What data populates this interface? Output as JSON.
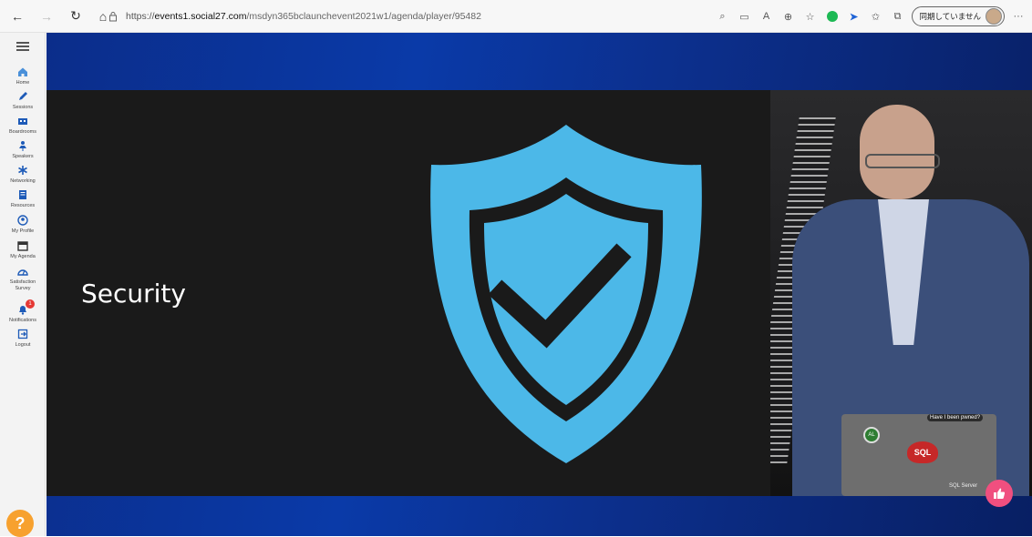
{
  "browser": {
    "url_prefix": "https://",
    "url_host": "events1.social27.com",
    "url_path": "/msdyn365bclaunchevent2021w1/agenda/player/95482",
    "sync_label": "同期していません",
    "more_label": "···"
  },
  "sidebar": {
    "items": [
      {
        "label": "Home",
        "icon": "home-icon"
      },
      {
        "label": "Sessions",
        "icon": "pencil-icon"
      },
      {
        "label": "Boardrooms",
        "icon": "boardroom-icon"
      },
      {
        "label": "Speakers",
        "icon": "speaker-icon"
      },
      {
        "label": "Networking",
        "icon": "networking-icon"
      },
      {
        "label": "Resources",
        "icon": "resources-icon"
      },
      {
        "label": "My Profile",
        "icon": "profile-icon"
      },
      {
        "label": "My Agenda",
        "icon": "calendar-icon"
      },
      {
        "label": "Satisfaction Survey",
        "icon": "survey-icon"
      },
      {
        "label": "Notifications",
        "icon": "bell-icon",
        "badge": "1"
      },
      {
        "label": "Logout",
        "icon": "logout-icon"
      }
    ],
    "help_label": "?"
  },
  "video": {
    "slide_title": "Security",
    "shield_color": "#4cb8e8",
    "stickers": {
      "sql": "SQL",
      "pwned": "Have I been pwned?",
      "sql_server": "SQL Server",
      "green": "AL"
    }
  },
  "colors": {
    "accent_pink": "#f04f7f",
    "help_orange": "#f7a12f",
    "stage_blue": "#0a3aa8"
  }
}
